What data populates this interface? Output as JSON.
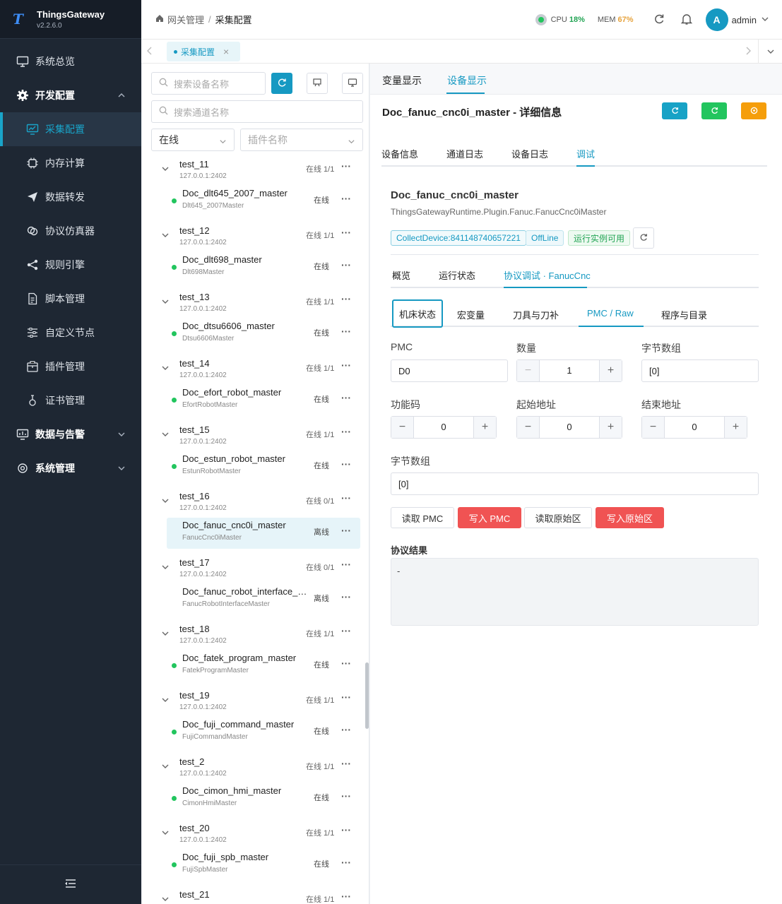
{
  "app": {
    "name": "ThingsGateway",
    "version": "v2.2.6.0",
    "logo_letter": "T"
  },
  "sidebar": {
    "items": [
      {
        "label": "系统总览",
        "icon": "monitor-icon"
      },
      {
        "label": "开发配置",
        "icon": "gear-icon",
        "expanded": true
      },
      {
        "label": "采集配置",
        "icon": "chart-screen-icon",
        "active": true
      },
      {
        "label": "内存计算",
        "icon": "chip-icon"
      },
      {
        "label": "数据转发",
        "icon": "send-icon"
      },
      {
        "label": "协议仿真器",
        "icon": "link-icon"
      },
      {
        "label": "规则引擎",
        "icon": "share-icon"
      },
      {
        "label": "脚本管理",
        "icon": "file-icon"
      },
      {
        "label": "自定义节点",
        "icon": "sliders-icon"
      },
      {
        "label": "插件管理",
        "icon": "package-icon"
      },
      {
        "label": "证书管理",
        "icon": "certificate-icon"
      },
      {
        "label": "数据与告警",
        "icon": "monitor-chart-icon"
      },
      {
        "label": "系统管理",
        "icon": "settings-icon"
      }
    ]
  },
  "header": {
    "breadcrumb": [
      "网关管理",
      "采集配置"
    ],
    "cpu_label": "CPU",
    "cpu_value": "18%",
    "mem_label": "MEM",
    "mem_value": "67%",
    "user": "admin",
    "avatar_letter": "A"
  },
  "tabbar": {
    "tabs": [
      {
        "label": "采集配置",
        "close": "×"
      }
    ]
  },
  "left": {
    "search_device_placeholder": "搜索设备名称",
    "search_channel_placeholder": "搜索通道名称",
    "status_select": "在线",
    "plugin_select_placeholder": "插件名称",
    "groups": [
      {
        "name": "test_11",
        "ip": "127.0.0.1:2402",
        "status": "在线 1/1",
        "device": {
          "name": "Doc_dlt645_2007_master",
          "plugin": "Dlt645_2007Master",
          "status": "在线",
          "online": true
        }
      },
      {
        "name": "test_12",
        "ip": "127.0.0.1:2402",
        "status": "在线 1/1",
        "device": {
          "name": "Doc_dlt698_master",
          "plugin": "Dlt698Master",
          "status": "在线",
          "online": true
        }
      },
      {
        "name": "test_13",
        "ip": "127.0.0.1:2402",
        "status": "在线 1/1",
        "device": {
          "name": "Doc_dtsu6606_master",
          "plugin": "Dtsu6606Master",
          "status": "在线",
          "online": true
        }
      },
      {
        "name": "test_14",
        "ip": "127.0.0.1:2402",
        "status": "在线 1/1",
        "device": {
          "name": "Doc_efort_robot_master",
          "plugin": "EfortRobotMaster",
          "status": "在线",
          "online": true
        }
      },
      {
        "name": "test_15",
        "ip": "127.0.0.1:2402",
        "status": "在线 1/1",
        "device": {
          "name": "Doc_estun_robot_master",
          "plugin": "EstunRobotMaster",
          "status": "在线",
          "online": true
        }
      },
      {
        "name": "test_16",
        "ip": "127.0.0.1:2402",
        "status": "在线 0/1",
        "device": {
          "name": "Doc_fanuc_cnc0i_master",
          "plugin": "FanucCnc0iMaster",
          "status": "离线",
          "online": false,
          "selected": true
        }
      },
      {
        "name": "test_17",
        "ip": "127.0.0.1:2402",
        "status": "在线 0/1",
        "device": {
          "name": "Doc_fanuc_robot_interface_m...",
          "plugin": "FanucRobotInterfaceMaster",
          "status": "离线",
          "online": false
        }
      },
      {
        "name": "test_18",
        "ip": "127.0.0.1:2402",
        "status": "在线 1/1",
        "device": {
          "name": "Doc_fatek_program_master",
          "plugin": "FatekProgramMaster",
          "status": "在线",
          "online": true
        }
      },
      {
        "name": "test_19",
        "ip": "127.0.0.1:2402",
        "status": "在线 1/1",
        "device": {
          "name": "Doc_fuji_command_master",
          "plugin": "FujiCommandMaster",
          "status": "在线",
          "online": true
        }
      },
      {
        "name": "test_2",
        "ip": "127.0.0.1:2402",
        "status": "在线 1/1",
        "device": {
          "name": "Doc_cimon_hmi_master",
          "plugin": "CimonHmiMaster",
          "status": "在线",
          "online": true
        }
      },
      {
        "name": "test_20",
        "ip": "127.0.0.1:2402",
        "status": "在线 1/1",
        "device": {
          "name": "Doc_fuji_spb_master",
          "plugin": "FujiSpbMaster",
          "status": "在线",
          "online": true
        }
      },
      {
        "name": "test_21",
        "ip": "",
        "status": "在线 1/1",
        "device": null
      }
    ]
  },
  "right": {
    "top_tabs": [
      "变量显示",
      "设备显示"
    ],
    "detail_title": "Doc_fanuc_cnc0i_master - 详细信息",
    "info_tabs": [
      "设备信息",
      "通道日志",
      "设备日志",
      "调试"
    ],
    "device_name": "Doc_fanuc_cnc0i_master",
    "plugin_full": "ThingsGatewayRuntime.Plugin.Fanuc.FanucCnc0iMaster",
    "badges": [
      "CollectDevice:841148740657221",
      "OffLine",
      "运行实例可用"
    ],
    "sub_tabs": [
      "概览",
      "运行状态",
      "协议调试 · FanucCnc"
    ],
    "proto_tabs": [
      "机床状态",
      "宏变量",
      "刀具与刀补",
      "PMC / Raw",
      "程序与目录"
    ],
    "form": {
      "pmc_label": "PMC",
      "pmc_value": "D0",
      "count_label": "数量",
      "count_value": "1",
      "bytes_label": "字节数组",
      "bytes_value": "[0]",
      "func_label": "功能码",
      "func_value": "0",
      "start_label": "起始地址",
      "start_value": "0",
      "end_label": "结束地址",
      "end_value": "0",
      "bytes2_label": "字节数组",
      "bytes2_value": "[0]"
    },
    "actions": [
      "读取 PMC",
      "写入 PMC",
      "读取原始区",
      "写入原始区"
    ],
    "result_label": "协议结果",
    "result_value": "-"
  }
}
